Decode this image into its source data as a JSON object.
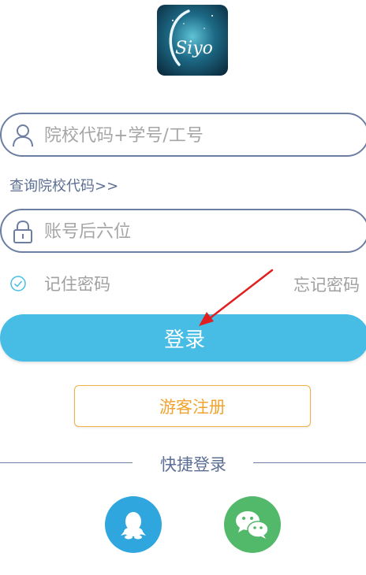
{
  "logo": {
    "icon": "app-logo-icon",
    "text": "Siyo"
  },
  "login_form": {
    "school_id_field": {
      "icon": "user-icon",
      "placeholder": "院校代码+学号/工号",
      "value": ""
    },
    "query_school_code_link": "查询院校代码>>",
    "password_field": {
      "icon": "lock-icon",
      "placeholder": "账号后六位",
      "value": ""
    },
    "remember_password": {
      "label": "记住密码",
      "checked": false
    },
    "forgot_password_link": "忘记密码",
    "login_button": "登录",
    "guest_register_button": "游客注册"
  },
  "quick_login": {
    "title": "快捷登录",
    "options": [
      {
        "icon": "qq-icon",
        "color": "#2fa6de"
      },
      {
        "icon": "wechat-icon",
        "color": "#52b96b"
      }
    ]
  },
  "colors": {
    "primary": "#47bde5",
    "border": "#6c7fa2",
    "guest": "#f0a330",
    "annotation_arrow": "#e02020"
  }
}
